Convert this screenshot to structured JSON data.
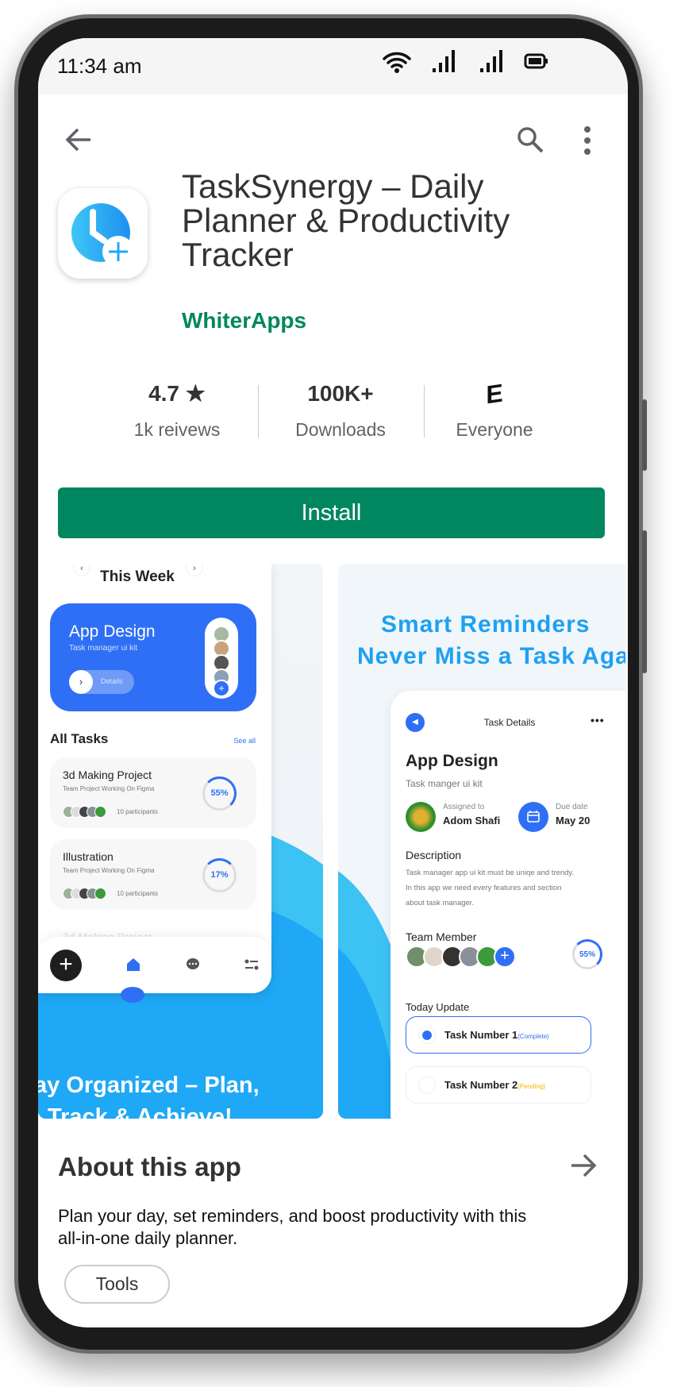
{
  "status_bar": {
    "time": "11:34 am",
    "icons": [
      "wifi-icon",
      "signal-icon",
      "signal-icon",
      "battery-icon"
    ]
  },
  "toolbar": {
    "back_icon": "arrow-left-icon",
    "search_icon": "search-icon",
    "more_icon": "more-vertical-icon"
  },
  "app": {
    "title_lines": [
      "TaskSynergy – Daily",
      "Planner & Productivity",
      "Tracker"
    ],
    "developer": "WhiterApps",
    "icon": "clock-plus-icon"
  },
  "stats": {
    "rating": "4.7",
    "rating_icon": "star-icon",
    "reviews": "1k reivews",
    "downloads": "100K+",
    "downloads_label": "Downloads",
    "content_rating_icon": "E",
    "content_rating": "Everyone"
  },
  "install_label": "Install",
  "screenshot1": {
    "week_title": "This Week",
    "featured": {
      "title": "App Design",
      "subtitle": "Task manager ui kit",
      "details": "Details"
    },
    "all_tasks": "All Tasks",
    "see_all": "See all",
    "tasks": [
      {
        "title": "3d Making Project",
        "subtitle": "Team Project Working On Figma",
        "participants": "10 participants",
        "progress": "55%"
      },
      {
        "title": "Illustration",
        "subtitle": "Team Project Working On Figma",
        "participants": "10 participants",
        "progress": "17%"
      }
    ],
    "faded_task": "3d Making Project",
    "caption_lines": [
      "ay Organized – Plan,",
      "Track & Achieve!"
    ]
  },
  "screenshot2": {
    "headline_lines": [
      "Smart Reminders",
      "Never Miss a Task Aga"
    ],
    "header": "Task Details",
    "title": "App Design",
    "subtitle": "Task manger ui kit",
    "assigned_label": "Assigned to",
    "assigned_name": "Adom Shafi",
    "due_label": "Due date",
    "due_value": "May 20",
    "description_title": "Description",
    "description_lines": [
      "Task manager app ui kit must be uniqe and trendy.",
      "In this app we need every features and section",
      "about task manager."
    ],
    "team_title": "Team Member",
    "team_progress": "55%",
    "today_title": "Today Update",
    "updates": [
      {
        "name": "Task Number 1",
        "status": "(Complete)"
      },
      {
        "name": "Task Number 2",
        "status": "(Pending)"
      }
    ]
  },
  "about": {
    "title": "About this app",
    "description_lines": [
      "Plan your day, set reminders, and boost productivity with this",
      "all-in-one daily planner."
    ],
    "tag": "Tools"
  },
  "colors": {
    "accent_green": "#01875f",
    "brand_blue": "#2f6ff5",
    "sky_blue": "#1fa8f5",
    "pending": "#f5b400"
  }
}
